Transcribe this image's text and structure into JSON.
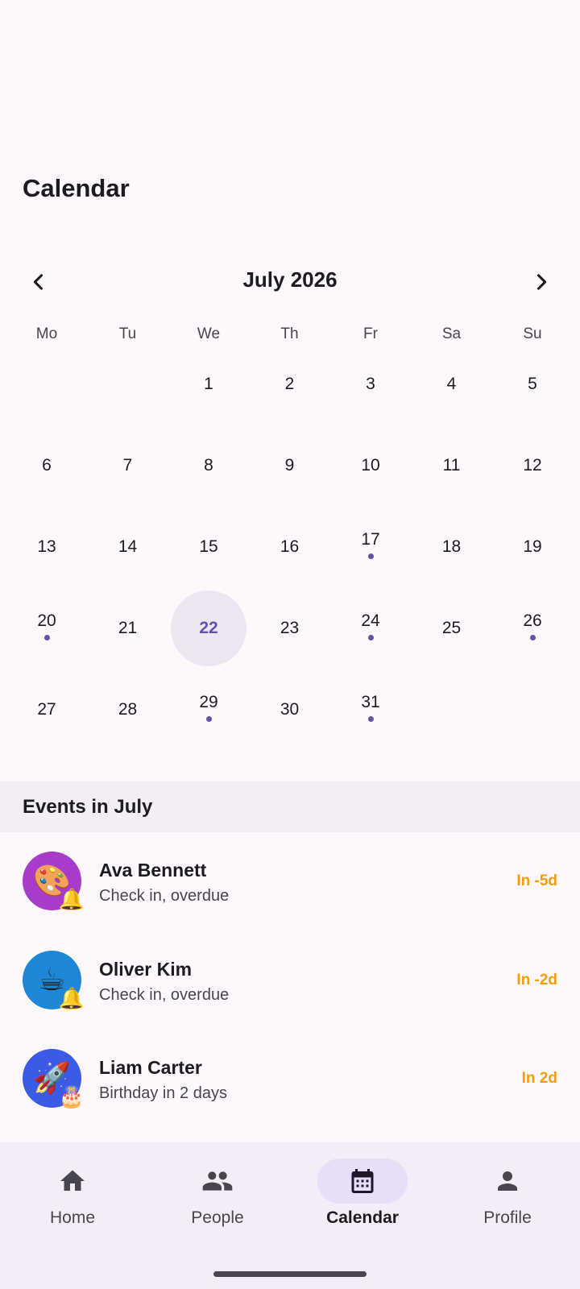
{
  "page": {
    "title": "Calendar"
  },
  "calendar": {
    "month_label": "July 2026",
    "weekdays": [
      "Mo",
      "Tu",
      "We",
      "Th",
      "Fr",
      "Sa",
      "Su"
    ],
    "selected_day": 22,
    "days": [
      {
        "label": "1",
        "col": 2,
        "row": 0,
        "event": false
      },
      {
        "label": "2",
        "col": 3,
        "row": 0,
        "event": false
      },
      {
        "label": "3",
        "col": 4,
        "row": 0,
        "event": false
      },
      {
        "label": "4",
        "col": 5,
        "row": 0,
        "event": false
      },
      {
        "label": "5",
        "col": 6,
        "row": 0,
        "event": false
      },
      {
        "label": "6",
        "col": 0,
        "row": 1,
        "event": false
      },
      {
        "label": "7",
        "col": 1,
        "row": 1,
        "event": false
      },
      {
        "label": "8",
        "col": 2,
        "row": 1,
        "event": false
      },
      {
        "label": "9",
        "col": 3,
        "row": 1,
        "event": false
      },
      {
        "label": "10",
        "col": 4,
        "row": 1,
        "event": false
      },
      {
        "label": "11",
        "col": 5,
        "row": 1,
        "event": false
      },
      {
        "label": "12",
        "col": 6,
        "row": 1,
        "event": false
      },
      {
        "label": "13",
        "col": 0,
        "row": 2,
        "event": false
      },
      {
        "label": "14",
        "col": 1,
        "row": 2,
        "event": false
      },
      {
        "label": "15",
        "col": 2,
        "row": 2,
        "event": false
      },
      {
        "label": "16",
        "col": 3,
        "row": 2,
        "event": false
      },
      {
        "label": "17",
        "col": 4,
        "row": 2,
        "event": true
      },
      {
        "label": "18",
        "col": 5,
        "row": 2,
        "event": false
      },
      {
        "label": "19",
        "col": 6,
        "row": 2,
        "event": false
      },
      {
        "label": "20",
        "col": 0,
        "row": 3,
        "event": true
      },
      {
        "label": "21",
        "col": 1,
        "row": 3,
        "event": false
      },
      {
        "label": "22",
        "col": 2,
        "row": 3,
        "event": false
      },
      {
        "label": "23",
        "col": 3,
        "row": 3,
        "event": false
      },
      {
        "label": "24",
        "col": 4,
        "row": 3,
        "event": true
      },
      {
        "label": "25",
        "col": 5,
        "row": 3,
        "event": false
      },
      {
        "label": "26",
        "col": 6,
        "row": 3,
        "event": true
      },
      {
        "label": "27",
        "col": 0,
        "row": 4,
        "event": false
      },
      {
        "label": "28",
        "col": 1,
        "row": 4,
        "event": false
      },
      {
        "label": "29",
        "col": 2,
        "row": 4,
        "event": true
      },
      {
        "label": "30",
        "col": 3,
        "row": 4,
        "event": false
      },
      {
        "label": "31",
        "col": 4,
        "row": 4,
        "event": true
      }
    ]
  },
  "events": {
    "header": "Events in July",
    "items": [
      {
        "name": "Ava Bennett",
        "subtitle": "Check in, overdue",
        "when": "In -5d",
        "avatar_emoji": "🎨",
        "badge_emoji": "🔔",
        "avatar_color": "#a63cc9"
      },
      {
        "name": "Oliver Kim",
        "subtitle": "Check in, overdue",
        "when": "In -2d",
        "avatar_emoji": "☕",
        "badge_emoji": "🔔",
        "avatar_color": "#1e88d8"
      },
      {
        "name": "Liam Carter",
        "subtitle": "Birthday in 2 days",
        "when": "In 2d",
        "avatar_emoji": "🚀",
        "badge_emoji": "🎂",
        "avatar_color": "#3b5ae6"
      }
    ]
  },
  "colors": {
    "accent": "#6750a4",
    "due": "#f29e0c",
    "nav_bg": "#f3edf7",
    "selected_bg": "#ece6f3"
  },
  "nav": {
    "items": [
      {
        "label": "Home",
        "icon": "home-icon",
        "active": false
      },
      {
        "label": "People",
        "icon": "people-icon",
        "active": false
      },
      {
        "label": "Calendar",
        "icon": "calendar-icon",
        "active": true
      },
      {
        "label": "Profile",
        "icon": "profile-icon",
        "active": false
      }
    ]
  }
}
